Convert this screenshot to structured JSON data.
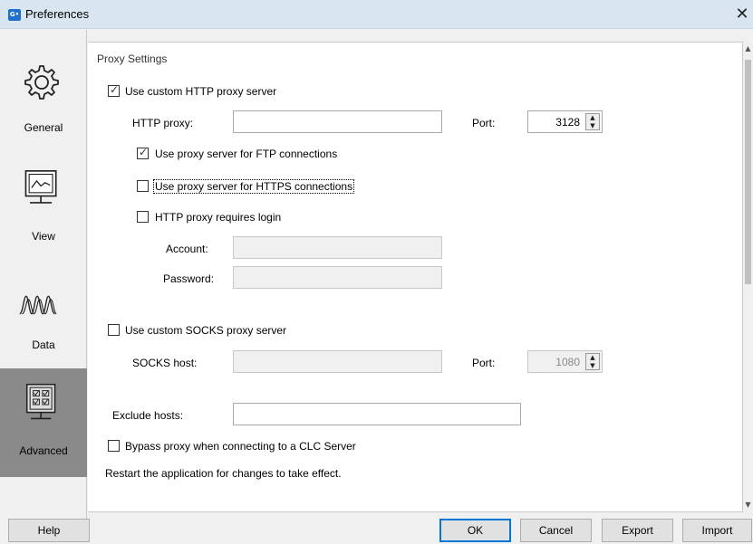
{
  "window": {
    "title": "Preferences",
    "app_icon_text": "G•",
    "close_glyph": "✕"
  },
  "sidebar": {
    "items": [
      {
        "label": "General",
        "icon": "gear-icon",
        "active": false
      },
      {
        "label": "View",
        "icon": "monitor-chart-icon",
        "active": false
      },
      {
        "label": "Data",
        "icon": "waveform-icon",
        "active": false
      },
      {
        "label": "Advanced",
        "icon": "checklist-monitor-icon",
        "active": true
      }
    ]
  },
  "proxy": {
    "section_title": "Proxy Settings",
    "use_http_proxy": {
      "label": "Use custom HTTP proxy server",
      "checked": true
    },
    "http_proxy_label": "HTTP proxy:",
    "http_proxy_value": "",
    "http_port_label": "Port:",
    "http_port_value": "3128",
    "ftp": {
      "label": "Use proxy server for FTP connections",
      "checked": true
    },
    "https": {
      "label": "Use proxy server for HTTPS connections",
      "checked": false
    },
    "login": {
      "label": "HTTP proxy requires login",
      "checked": false
    },
    "account_label": "Account:",
    "account_value": "",
    "password_label": "Password:",
    "password_value": "",
    "use_socks": {
      "label": "Use custom SOCKS proxy server",
      "checked": false
    },
    "socks_host_label": "SOCKS host:",
    "socks_host_value": "",
    "socks_port_label": "Port:",
    "socks_port_value": "1080",
    "exclude_label": "Exclude hosts:",
    "exclude_value": "",
    "bypass": {
      "label": "Bypass proxy when connecting to a CLC Server",
      "checked": false
    },
    "restart_note": "Restart the application for changes to take effect."
  },
  "buttons": {
    "help": "Help",
    "ok": "OK",
    "cancel": "Cancel",
    "export": "Export",
    "import": "Import"
  },
  "colors": {
    "active_sidebar": "#8a8a8a",
    "titlebar": "#d9e6f2",
    "default_button_border": "#0078d7"
  }
}
